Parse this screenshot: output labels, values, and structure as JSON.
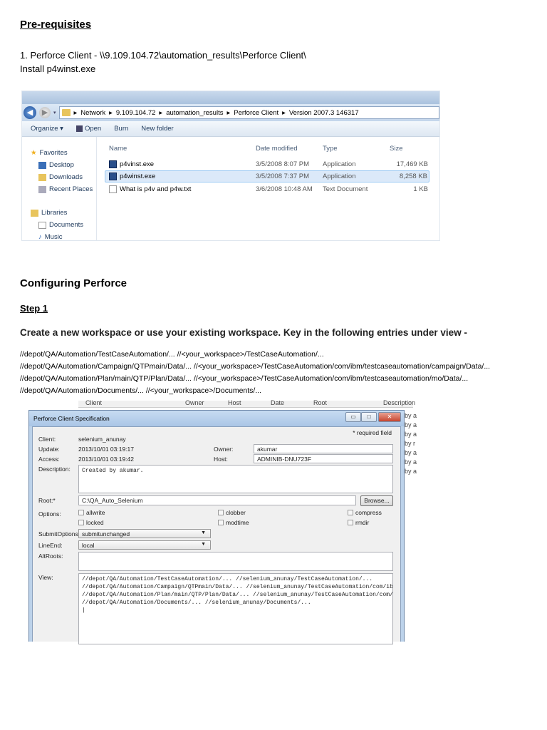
{
  "prereq": {
    "heading": "Pre-requisites",
    "line1": "1. Perforce Client - \\\\9.109.104.72\\automation_results\\Perforce Client\\",
    "line2": "Install p4winst.exe"
  },
  "explorer": {
    "breadcrumb": [
      "Network",
      "9.109.104.72",
      "automation_results",
      "Perforce Client",
      "Version 2007.3 146317"
    ],
    "toolbar": {
      "organize": "Organize ▾",
      "open": "Open",
      "burn": "Burn",
      "new_folder": "New folder"
    },
    "sidebar": {
      "favorites": "Favorites",
      "favorites_items": [
        "Desktop",
        "Downloads",
        "Recent Places"
      ],
      "libraries": "Libraries",
      "libraries_items": [
        "Documents",
        "Music"
      ]
    },
    "columns": [
      "Name",
      "Date modified",
      "Type",
      "Size"
    ],
    "files": [
      {
        "name": "p4vinst.exe",
        "date": "3/5/2008 8:07 PM",
        "type": "Application",
        "size": "17,469 KB",
        "icon": "exe-icon",
        "selected": false
      },
      {
        "name": "p4winst.exe",
        "date": "3/5/2008 7:37 PM",
        "type": "Application",
        "size": "8,258 KB",
        "icon": "exe-icon",
        "selected": true
      },
      {
        "name": "What is p4v and p4w.txt",
        "date": "3/6/2008 10:48 AM",
        "type": "Text Document",
        "size": "1 KB",
        "icon": "text-file-icon",
        "selected": false
      }
    ]
  },
  "config": {
    "heading": "Configuring Perforce",
    "step": "Step 1",
    "instruction": "Create a new workspace or use your existing workspace. Key in the following entries under view -",
    "mappings": [
      "//depot/QA/Automation/TestCaseAutomation/... //<your_workspace>/TestCaseAutomation/...",
      "//depot/QA/Automation/Campaign/QTPmain/Data/... //<your_workspace>/TestCaseAutomation/com/ibm/testcaseautomation/campaign/Data/...",
      "//depot/QA/Automation/Plan/main/QTP/Plan/Data/... //<your_workspace>/TestCaseAutomation/com/ibm/testcaseautomation/mo/Data/...",
      "//depot/QA/Automation/Documents/... //<your_workspace>/Documents/..."
    ]
  },
  "bg_list": {
    "columns": [
      "Client",
      "Owner",
      "Host",
      "Date",
      "Root",
      "Description"
    ],
    "description_snippets": [
      "by a",
      "by a",
      "by a",
      "by r",
      "by a",
      "by a",
      "by a"
    ]
  },
  "dialog": {
    "title": "Perforce Client Specification",
    "required_note": "* required field",
    "client_label": "Client:",
    "client": "selenium_anunay",
    "update_label": "Update:",
    "update": "2013/10/01 03:19:17",
    "access_label": "Access:",
    "access": "2013/10/01 03:19:42",
    "owner_label": "Owner:",
    "owner": "akumar",
    "host_label": "Host:",
    "host": "ADMINIB-DNU723F",
    "description_label": "Description:",
    "description": "Created by akumar.",
    "root_label": "Root:*",
    "root": "C:\\QA_Auto_Selenium",
    "browse": "Browse...",
    "options_label": "Options:",
    "options": [
      {
        "label": "allwrite",
        "checked": false
      },
      {
        "label": "clobber",
        "checked": false
      },
      {
        "label": "compress",
        "checked": false
      },
      {
        "label": "locked",
        "checked": false
      },
      {
        "label": "modtime",
        "checked": false
      },
      {
        "label": "rmdir",
        "checked": false
      }
    ],
    "submit_options_label": "SubmitOptions:",
    "submit_options": "submitunchanged",
    "line_end_label": "LineEnd:",
    "line_end": "local",
    "alt_roots_label": "AltRoots:",
    "alt_roots": "",
    "view_label": "View:",
    "view": "//depot/QA/Automation/TestCaseAutomation/... //selenium_anunay/TestCaseAutomation/...\n//depot/QA/Automation/Campaign/QTPmain/Data/... //selenium_anunay/TestCaseAutomation/com/ibm\n//depot/QA/Automation/Plan/main/QTP/Plan/Data/... //selenium_anunay/TestCaseAutomation/com/i\n//depot/QA/Automation/Documents/... //selenium_anunay/Documents/...\n|"
  }
}
